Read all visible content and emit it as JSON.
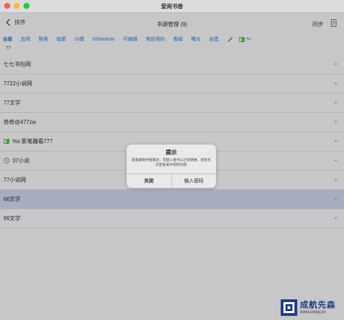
{
  "window": {
    "title": "爱阅书香"
  },
  "navbar": {
    "back_label": "排序",
    "title": "书源管理 (9)",
    "sync_label": "同步"
  },
  "groups": {
    "tabs": [
      {
        "label": "全部",
        "active": true
      },
      {
        "label": "启用",
        "active": false
      },
      {
        "label": "禁用",
        "active": false
      },
      {
        "label": "临聚",
        "active": false
      },
      {
        "label": "16聚",
        "active": false
      },
      {
        "label": "fsfsfadmin",
        "active": false
      },
      {
        "label": "可编辑",
        "active": false
      },
      {
        "label": "常启用的",
        "active": false
      },
      {
        "label": "看磁",
        "active": false
      },
      {
        "label": "曙光",
        "active": false
      },
      {
        "label": "自建",
        "active": false
      }
    ],
    "thumb_label": "%s"
  },
  "search": {
    "value": "77"
  },
  "list": {
    "rows": [
      {
        "label": "七七书包网",
        "count": "40"
      },
      {
        "label": "7722小说网",
        "count": "40"
      },
      {
        "label": "77文学",
        "count": "40"
      },
      {
        "label": "奇奇@477zw",
        "count": "40"
      },
      {
        "label": "%s 影笔趣看777",
        "count": "40",
        "icon": "book-icon"
      },
      {
        "label": "37小说",
        "count": "40",
        "icon": "clock-icon"
      },
      {
        "label": "77小说网",
        "count": "40"
      },
      {
        "label": "66文学",
        "count": "40",
        "selected": true
      },
      {
        "label": "99文学",
        "count": "40"
      }
    ]
  },
  "dialog": {
    "title": "提示",
    "message": "配置被制作者锁定，同登入者可以正常使用。但您无法查看其中规则内容!",
    "close_label": "关闭",
    "password_label": "输入密码"
  },
  "watermark": {
    "name": "成航先森",
    "url": "www.cenjsj.cn"
  },
  "colors": {
    "background": "#c7c7c9",
    "selected_row": "#a9aebf",
    "accent": "#2a5db0"
  }
}
